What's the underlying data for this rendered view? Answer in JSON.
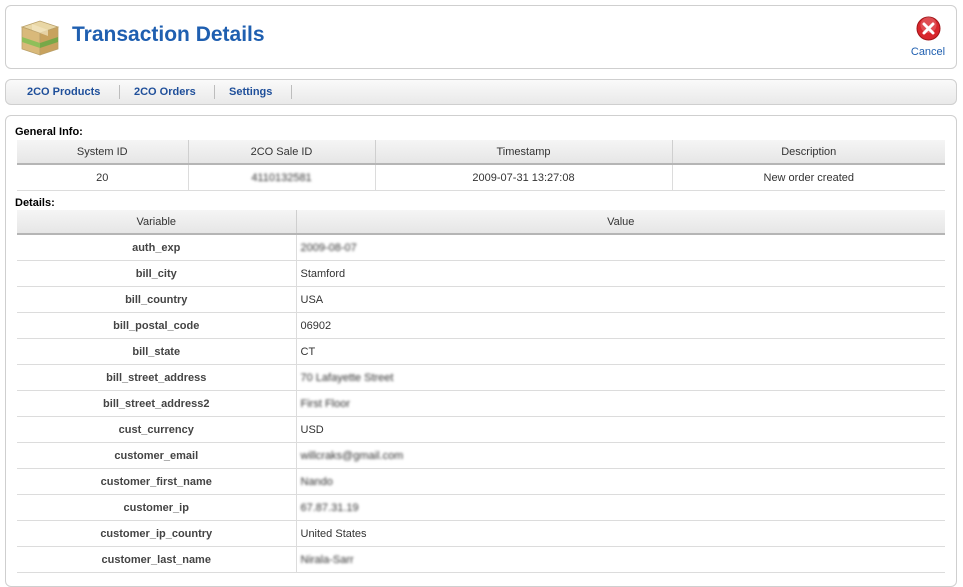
{
  "header": {
    "title": "Transaction Details",
    "cancel_label": "Cancel"
  },
  "toolbar": {
    "tabs": [
      "2CO Products",
      "2CO Orders",
      "Settings"
    ]
  },
  "general": {
    "label": "General Info:",
    "columns": [
      "System ID",
      "2CO Sale ID",
      "Timestamp",
      "Description"
    ],
    "row": [
      "20",
      "4110132581",
      "2009-07-31 13:27:08",
      "New order created"
    ]
  },
  "details": {
    "label": "Details:",
    "columns": [
      "Variable",
      "Value"
    ],
    "rows": [
      [
        "auth_exp",
        "2009-08-07"
      ],
      [
        "bill_city",
        "Stamford"
      ],
      [
        "bill_country",
        "USA"
      ],
      [
        "bill_postal_code",
        "06902"
      ],
      [
        "bill_state",
        "CT"
      ],
      [
        "bill_street_address",
        "70 Lafayette Street"
      ],
      [
        "bill_street_address2",
        "First Floor"
      ],
      [
        "cust_currency",
        "USD"
      ],
      [
        "customer_email",
        "willcraks@gmail.com"
      ],
      [
        "customer_first_name",
        "Nando"
      ],
      [
        "customer_ip",
        "67.87.31.19"
      ],
      [
        "customer_ip_country",
        "United States"
      ],
      [
        "customer_last_name",
        "Nirala-Sarr"
      ]
    ]
  }
}
